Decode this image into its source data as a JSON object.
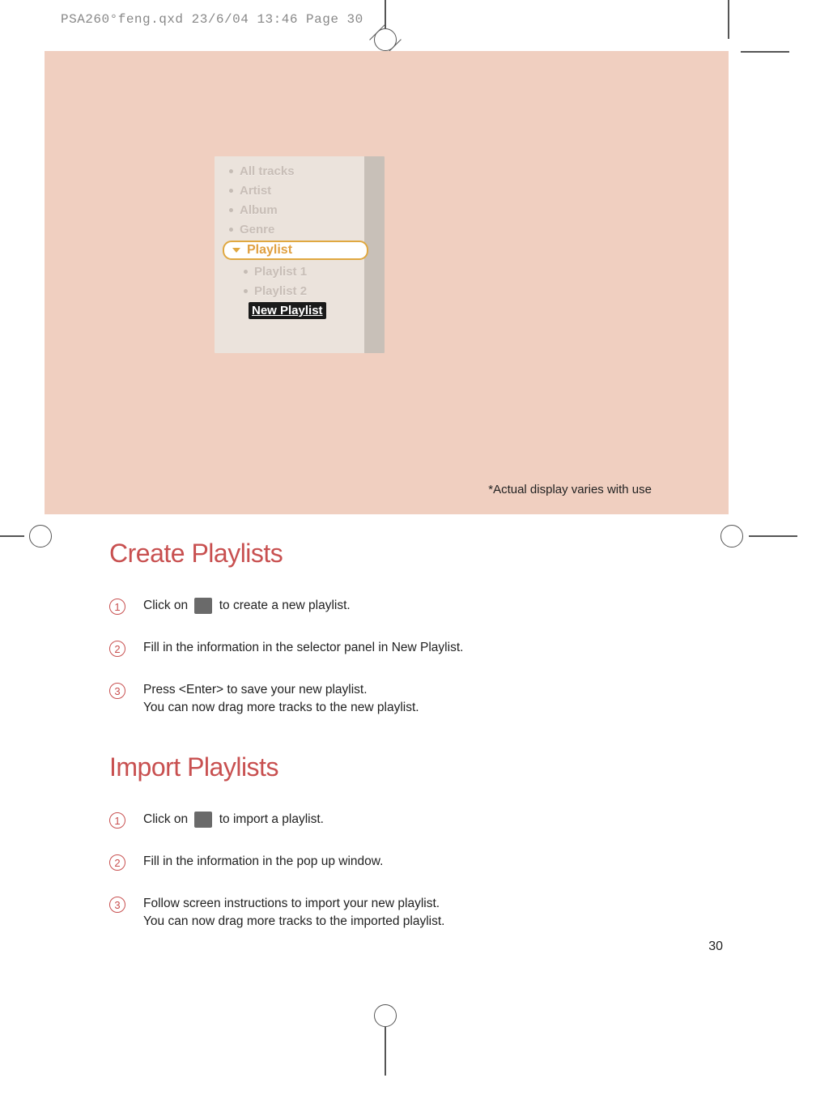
{
  "header": "PSA260°feng.qxd  23/6/04  13:46  Page 30",
  "screenshot": {
    "items": [
      "All tracks",
      "Artist",
      "Album",
      "Genre"
    ],
    "selected": "Playlist",
    "subitems": [
      "Playlist 1",
      "Playlist 2"
    ],
    "new_item": "New Playlist"
  },
  "disclaimer": "*Actual display varies with use",
  "sections": [
    {
      "title": "Create Playlists",
      "steps": [
        {
          "num": "1",
          "pre": "Click on ",
          "post": " to create a new playlist.",
          "has_icon": true
        },
        {
          "num": "2",
          "text": "Fill in the information in the selector panel in New Playlist."
        },
        {
          "num": "3",
          "text": "Press <Enter> to save your new playlist.",
          "text2": "You can now drag more tracks to the new playlist."
        }
      ]
    },
    {
      "title": "Import Playlists",
      "steps": [
        {
          "num": "1",
          "pre": "Click on ",
          "post": " to import a playlist.",
          "has_icon": true
        },
        {
          "num": "2",
          "text": "Fill in the information in the pop up window."
        },
        {
          "num": "3",
          "text": "Follow screen instructions to import your new playlist.",
          "text2": "You can now drag more tracks to the imported playlist."
        }
      ]
    }
  ],
  "page_number": "30"
}
